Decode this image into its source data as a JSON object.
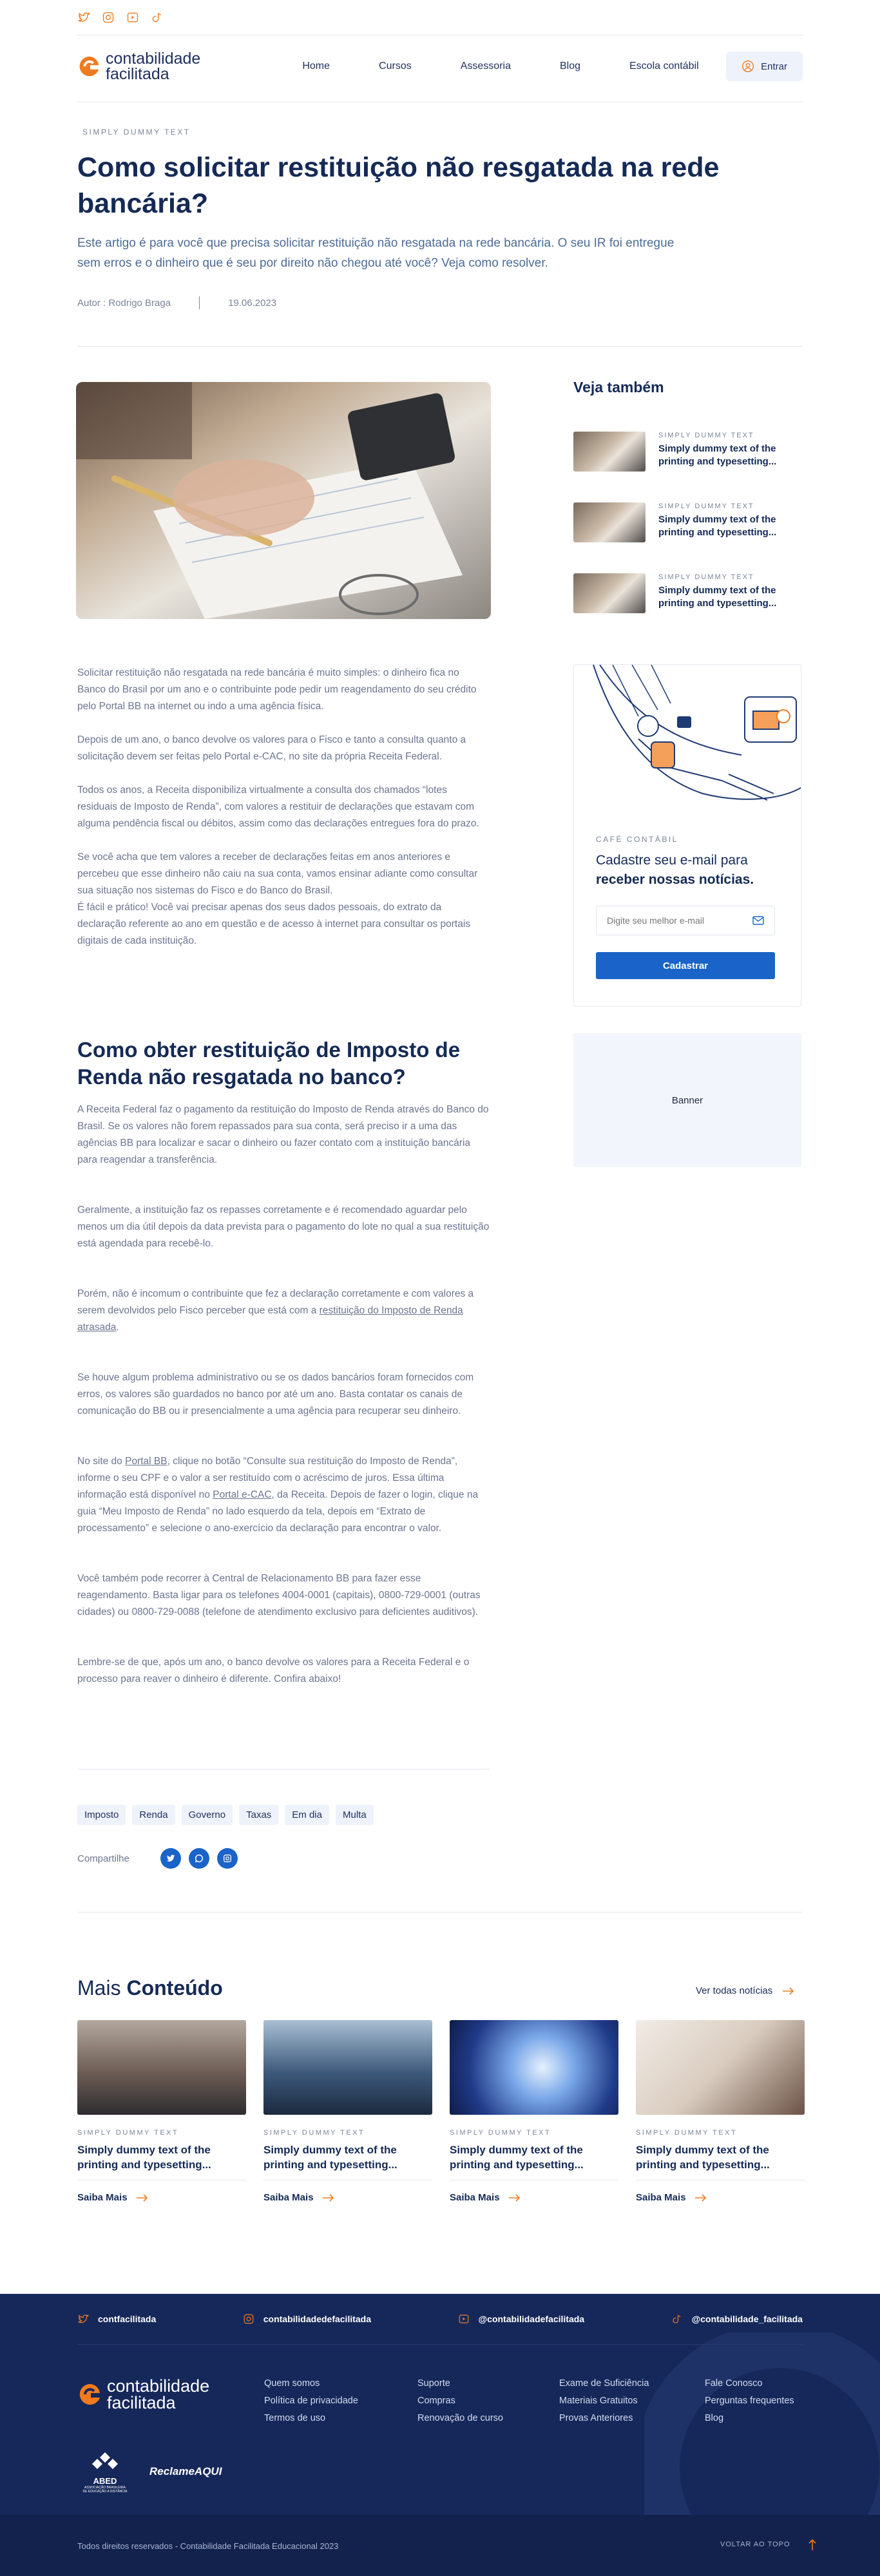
{
  "nav": {
    "logo_line1": "contabilidade",
    "logo_line2": "facilitada",
    "items": [
      "Home",
      "Cursos",
      "Assessoria",
      "Blog",
      "Escola contábil"
    ],
    "login_label": "Entrar"
  },
  "article": {
    "kicker": "SIMPLY DUMMY TEXT",
    "title": "Como solicitar restituição não resgatada na rede bancária?",
    "subtitle": "Este artigo é para você que precisa solicitar restituição não resgatada na rede bancária. O seu IR foi entregue sem erros e o dinheiro que é seu por direito não chegou até você? Veja como resolver.",
    "author": "Autor : Rodrigo Braga",
    "date": "19.06.2023",
    "paragraphs": [
      "Solicitar restituição não resgatada na rede bancária é muito simples: o dinheiro fica no Banco do Brasil por um ano e o contribuinte pode pedir um reagendamento do seu crédito pelo Portal BB na internet ou indo a uma agência física.",
      "Depois de um ano, o banco devolve os valores para o Fisco e tanto a consulta quanto a solicitação devem ser feitas pelo Portal e-CAC, no site da própria Receita Federal.",
      "Todos os anos, a Receita disponibiliza virtualmente a consulta dos chamados “lotes residuais de Imposto de Renda”, com valores a restituir de declarações que estavam com alguma pendência fiscal ou débitos, assim como das declarações entregues fora do prazo.",
      "Se você acha que tem valores a receber de declarações feitas em anos anteriores e percebeu que esse dinheiro não caiu na sua conta, vamos ensinar adiante como consultar sua situação nos sistemas do Fisco e do Banco do Brasil.\nÉ fácil e prático! Você vai precisar apenas dos seus dados pessoais, do extrato da declaração referente ao ano em questão e de acesso à internet para consultar os portais digitais de cada instituição."
    ],
    "section_title": "Como obter restituição de Imposto de Renda não resgatada no banco?",
    "section_p1": "A Receita Federal faz o pagamento da restituição do Imposto de Renda através do Banco do Brasil. Se os valores não forem repassados para sua conta, será preciso ir a uma das agências BB para localizar e sacar o dinheiro ou fazer contato com a instituição bancária para reagendar a transferência.",
    "section_p2": "Geralmente, a instituição faz os repasses corretamente e é recomendado aguardar pelo menos um dia útil depois da data prevista para o pagamento do lote no qual a sua restituição está agendada para recebê-lo.",
    "section_p3a": "Porém, não é incomum o contribuinte que fez a declaração corretamente e com valores a serem devolvidos pelo Fisco perceber que está com a ",
    "section_p3link": "restituição do Imposto de Renda atrasada",
    "section_p3b": ".",
    "section_p4": "Se houve algum problema administrativo ou se os dados bancários foram fornecidos com erros, os valores são guardados no banco por até um ano. Basta contatar os canais de comunicação do BB ou ir presencialmente a uma agência para recuperar seu dinheiro.",
    "section_p5a": "No site do ",
    "section_p5link1": "Portal BB",
    "section_p5b": ", clique no botão “Consulte sua restituição do Imposto de Renda”, informe o seu CPF e o valor a ser restituído com o acréscimo de juros. Essa última informação está disponível no ",
    "section_p5link2": "Portal e-CAC",
    "section_p5c": ", da Receita. Depois de fazer o login, clique na guia “Meu Imposto de Renda” no lado esquerdo da tela, depois em “Extrato de processamento” e selecione o ano-exercício da declaração para encontrar o valor.",
    "section_p6": "Você também pode recorrer à Central de Relacionamento BB para fazer esse reagendamento. Basta ligar para os telefones 4004-0001 (capitais), 0800-729-0001 (outras cidades) ou 0800-729-0088 (telefone de atendimento exclusivo para deficientes auditivos).",
    "section_p7": "Lembre-se de que, após um ano, o banco devolve os valores para a Receita Federal e o processo para reaver o dinheiro é diferente. Confira abaixo!",
    "tags": [
      "Imposto",
      "Renda",
      "Governo",
      "Taxas",
      "Em dia",
      "Multa"
    ],
    "share_label": "Compartilhe"
  },
  "sidebar": {
    "title": "Veja também",
    "items": [
      {
        "kicker": "SIMPLY DUMMY TEXT",
        "title": "Simply dummy text of the printing and typesetting..."
      },
      {
        "kicker": "SIMPLY DUMMY TEXT",
        "title": "Simply dummy text of the printing and typesetting..."
      },
      {
        "kicker": "SIMPLY DUMMY TEXT",
        "title": "Simply dummy text of the printing and typesetting..."
      }
    ],
    "newsletter": {
      "kicker": "CAFÉ CONTÁBIL",
      "title_a": "Cadastre seu e-mail para ",
      "title_b": "receber nossas notícias.",
      "placeholder": "Digite seu melhor e-mail",
      "button": "Cadastrar"
    },
    "banner": "Banner"
  },
  "more": {
    "title_a": "Mais ",
    "title_b": "Conteúdo",
    "see_all": "Ver todas notícias",
    "cards": [
      {
        "kicker": "SIMPLY DUMMY TEXT",
        "title": "Simply dummy text of the printing and typesetting...",
        "cta": "Saiba Mais"
      },
      {
        "kicker": "SIMPLY DUMMY TEXT",
        "title": "Simply dummy text of the printing and typesetting...",
        "cta": "Saiba Mais"
      },
      {
        "kicker": "SIMPLY DUMMY TEXT",
        "title": "Simply dummy text of the printing and typesetting...",
        "cta": "Saiba Mais"
      },
      {
        "kicker": "SIMPLY DUMMY TEXT",
        "title": "Simply dummy text of the printing and typesetting...",
        "cta": "Saiba Mais"
      }
    ]
  },
  "footer": {
    "socials": [
      "contfacilitada",
      "contabilidadedefacilitada",
      "@contabilidadefacilitada",
      "@contabilidade_facilitada"
    ],
    "col1": [
      "Quem somos",
      "Política de privacidade",
      "Termos de uso"
    ],
    "col2": [
      "Suporte",
      "Compras",
      "Renovação de curso"
    ],
    "col3": [
      "Exame de Suficiência",
      "Materiais Gratuitos",
      "Provas Anteriores"
    ],
    "col4": [
      "Fale Conosco",
      "Perguntas frequentes",
      "Blog"
    ],
    "abed_label": "ABED",
    "abed_sub": "ASSOCIAÇÃO BRASILEIRA DE EDUCAÇÃO A DISTÂNCIA",
    "reclame": "ReclameAQUI",
    "copyright": "Todos direitos reservados - Contabilidade Facilitada Educacional 2023",
    "back_top": "VOLTAR AO TOPO"
  },
  "colors": {
    "accent": "#f07b1e",
    "navy": "#152a55",
    "primary_blue": "#1a63c8",
    "footer_bg": "#16285a"
  }
}
